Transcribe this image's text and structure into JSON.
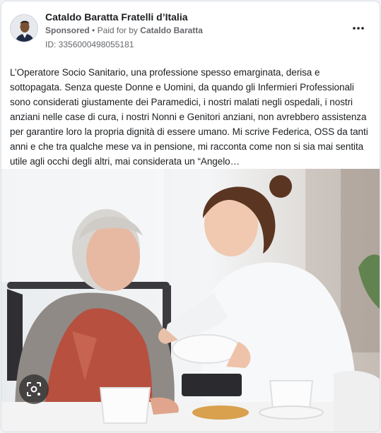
{
  "post": {
    "page_name": "Cataldo Baratta Fratelli d’Italia",
    "sponsored_label": "Sponsored",
    "separator": "•",
    "paid_for_prefix": "Paid for by",
    "paid_for_name": "Cataldo Baratta",
    "ad_id": "ID: 3356000498055181",
    "more_icon": "more-horizontal-icon",
    "body": "L’Operatore Socio Sanitario, una professione spesso emarginata, derisa e sottopagata. Senza queste Donne e Uomini, da quando gli Infermieri Professionali sono considerati giustamente dei Paramedici, i nostri malati negli ospedali, i nostri anziani nelle case di cura, i nostri Nonni e Genitori anziani, non avrebbero assistenza per garantire loro la propria dignità di essere umano. Mi scrive Federica, OSS da tanti anni e che tra qualche mese va in pensione, mi racconta come non si sia mai sentita utile agli occhi degli altri, mai considerata un “Angelo…",
    "media_icon": "visual-search-icon"
  },
  "colors": {
    "name_text": "#1c1e21",
    "meta_text": "#65676b",
    "card_bg": "#ffffff",
    "page_bg": "#f0f2f5"
  }
}
